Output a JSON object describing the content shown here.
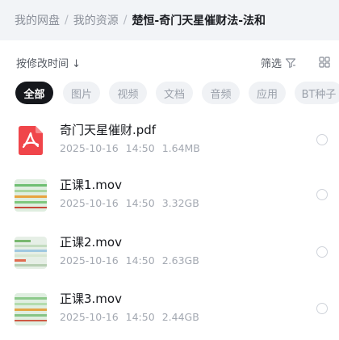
{
  "breadcrumb": {
    "items": [
      "我的网盘",
      "我的资源"
    ],
    "separator": "/",
    "current": "楚恒-奇门天星催财法-法和"
  },
  "toolbar": {
    "sort_label": "按修改时间 ↓",
    "filter_label": "筛选"
  },
  "chips": [
    "全部",
    "图片",
    "视频",
    "文档",
    "音频",
    "应用",
    "BT种子"
  ],
  "active_chip": "全部",
  "files": [
    {
      "name": "奇门天星催财.pdf",
      "date": "2025-10-16",
      "time": "14:50",
      "size": "1.64MB",
      "type": "pdf"
    },
    {
      "name": "正课1.mov",
      "date": "2025-10-16",
      "time": "14:50",
      "size": "3.32GB",
      "type": "video"
    },
    {
      "name": "正课2.mov",
      "date": "2025-10-16",
      "time": "14:50",
      "size": "2.63GB",
      "type": "video"
    },
    {
      "name": "正课3.mov",
      "date": "2025-10-16",
      "time": "14:50",
      "size": "2.44GB",
      "type": "video"
    }
  ],
  "colors": {
    "accent_dark": "#15171c",
    "pdf_red": "#f0454a",
    "breadcrumb_bg": "#f2f4f7"
  },
  "icons": {
    "pdf": "pdf-icon",
    "filter": "filter-icon",
    "view": "grid-view-icon"
  }
}
